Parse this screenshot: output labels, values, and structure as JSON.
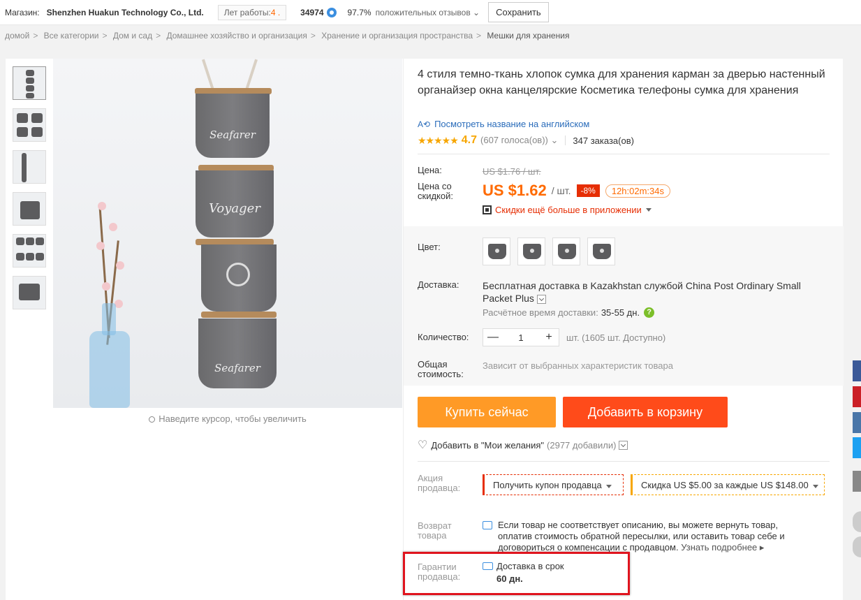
{
  "topbar": {
    "store_label": "Магазин:",
    "store_name": "Shenzhen Huakun Technology Co., Ltd.",
    "years_label": "Лет работы:",
    "years_value": "4 .",
    "score": "34974",
    "positive_pct": "97.7%",
    "feedback_label": "положительных отзывов",
    "save_label": "Сохранить"
  },
  "breadcrumb": [
    "домой",
    "Все категории",
    "Дом и сад",
    "Домашнее хозяйство и организация",
    "Хранение и организация пространства",
    "Мешки для хранения"
  ],
  "gallery": {
    "zoom_hint": "Наведите курсор, чтобы увеличить",
    "thumb_count": 6,
    "bag_marks": [
      "Seafarer",
      "Voyager",
      "",
      "Seafarer"
    ]
  },
  "product": {
    "title": "4 стиля темно-ткань хлопок сумка для хранения карман за дверью настенный органайзер окна канцелярские Косметика телефоны сумка для хранения",
    "translate_label": "Посмотреть название на английском",
    "rating": "4.7",
    "votes": "(607 голоса(ов))",
    "orders": "347 заказа(ов)",
    "price_label": "Цена:",
    "old_price": "US $1.76 / шт.",
    "discount_price_label": "Цена со скидкой:",
    "new_price": "US $1.62",
    "unit": "/ шт.",
    "discount": "-8%",
    "timer": "12h:02m:34s",
    "app_deal": "Скидки ещё больше в приложении",
    "color_label": "Цвет:",
    "shipping_label": "Доставка:",
    "shipping_text": "Бесплатная доставка в Kazakhstan службой China Post Ordinary Small Packet Plus",
    "eta_label": "Расчётное время доставки:",
    "eta_days": "35-55 дн.",
    "qty_label": "Количество:",
    "qty_value": "1",
    "qty_avail": "шт. (1605 шт. Доступно)",
    "total_label": "Общая стоимость:",
    "total_value": "Зависит от выбранных характеристик товара",
    "buy_label": "Купить сейчас",
    "cart_label": "Добавить в корзину",
    "wish_label": "Добавить в \"Мои желания\"",
    "wish_count": "(2977 добавили)",
    "promo_label": "Акция продавца:",
    "coupon_label": "Получить купон продавца",
    "discount_label": "Скидка US $5.00 за каждые US $148.00",
    "return_label": "Возврат товара",
    "return_text": "Если товар не соответствует описанию, вы можете вернуть товар, оплатив стоимость обратной пересылки, или оставить товар себе и договориться о компенсации с продавцом.",
    "return_more": "Узнать подробнее",
    "guarantee_label": "Гарантии продавца:",
    "guarantee_text": "Доставка в срок",
    "guarantee_days": "60 дн."
  },
  "colors": {
    "accent_orange": "#ff6a00",
    "buy_button": "#ff9a26",
    "cart_button": "#ff4b1a",
    "sale_red": "#e62e04",
    "link_blue": "#2a6cba",
    "highlight_box": "#e0141e"
  },
  "social_colors": [
    "#3b5998",
    "#cb2027",
    "#4a76a8",
    "#1da1f2",
    "#888888"
  ]
}
